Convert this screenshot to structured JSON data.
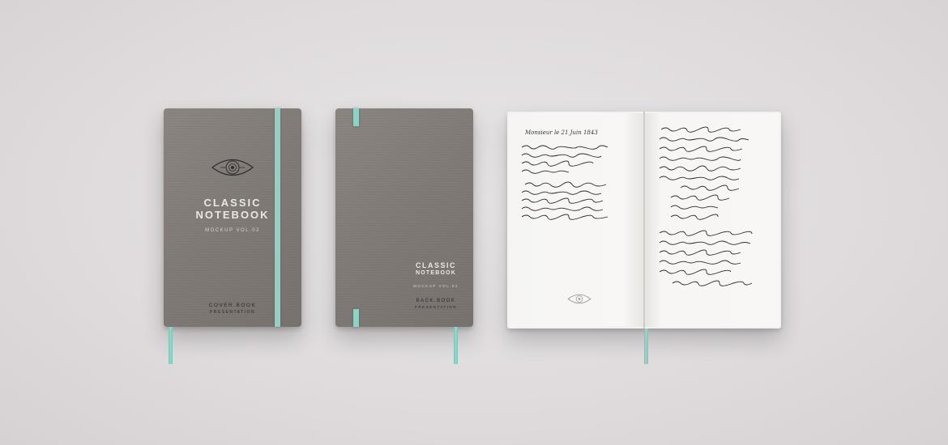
{
  "front_cover": {
    "title_line1": "CLASSIC",
    "title_line2": "NOTEBOOK",
    "subtitle": "MOCKUP VOL.02",
    "footer_line1": "COVER.BOOK",
    "footer_line2": "PRESENTATION"
  },
  "back_cover": {
    "title_line1": "CLASSIC",
    "title_line2": "NOTEBOOK",
    "subtitle": "MOCKUP VOL.02",
    "footer_line1": "BACK.BOOK",
    "footer_line2": "PRESENTATION"
  },
  "open_notebook": {
    "left_page_heading": "Monsieur le 21 Juin 1843"
  },
  "colors": {
    "background": "#e2dfe1",
    "cover": "#827c78",
    "band": "#8fd1c4",
    "page": "#f7f6f4",
    "ink": "#2d2b2a"
  },
  "icons": [
    "eye-emblem-icon"
  ]
}
